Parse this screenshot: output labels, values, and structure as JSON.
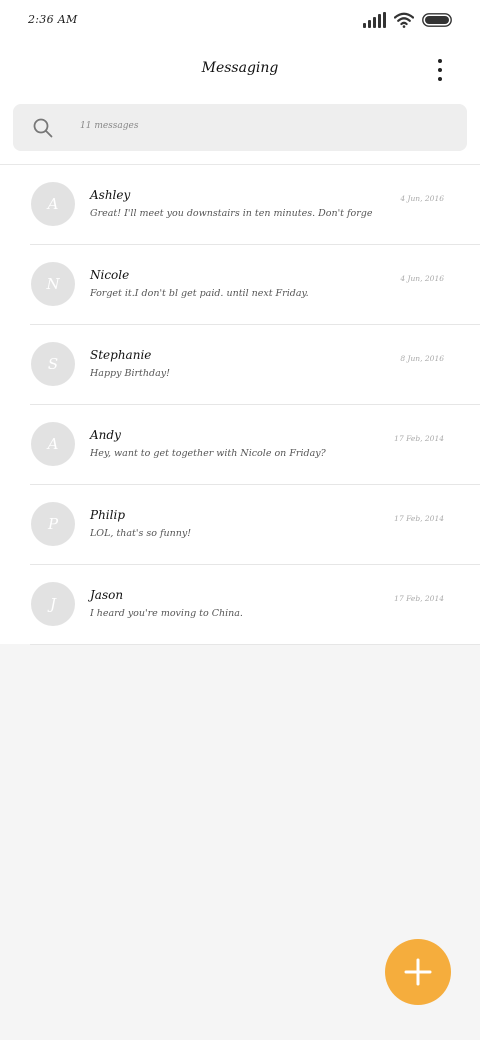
{
  "status_bar": {
    "time": "2:36 AM",
    "icons": [
      "signal-icon",
      "wifi-icon",
      "battery-icon"
    ]
  },
  "header": {
    "title": "Messaging",
    "menu_icon": "more-vertical-icon"
  },
  "search": {
    "placeholder": "11 messages",
    "icon": "search-icon"
  },
  "conversations": [
    {
      "initial": "A",
      "name": "Ashley",
      "preview": "Great! I'll meet you downstairs in ten minutes. Don't forge",
      "date": "4 Jun, 2016"
    },
    {
      "initial": "N",
      "name": "Nicole",
      "preview": "Forget it.I don't bl get paid. until next Friday.",
      "date": "4 Jun, 2016"
    },
    {
      "initial": "S",
      "name": "Stephanie",
      "preview": "Happy Birthday!",
      "date": "8 Jun, 2016"
    },
    {
      "initial": "A",
      "name": "Andy",
      "preview": "Hey, want to get together with Nicole on Friday?",
      "date": "17 Feb, 2014"
    },
    {
      "initial": "P",
      "name": "Philip",
      "preview": "LOL, that's so funny!",
      "date": "17 Feb, 2014"
    },
    {
      "initial": "J",
      "name": "Jason",
      "preview": "I heard you're moving to China.",
      "date": "17 Feb, 2014"
    }
  ],
  "fab": {
    "icon": "plus-icon"
  },
  "colors": {
    "accent": "#f5ad3d",
    "avatar_bg": "#e2e2e2",
    "background": "#f5f5f5",
    "search_bg": "#eeeeee"
  }
}
